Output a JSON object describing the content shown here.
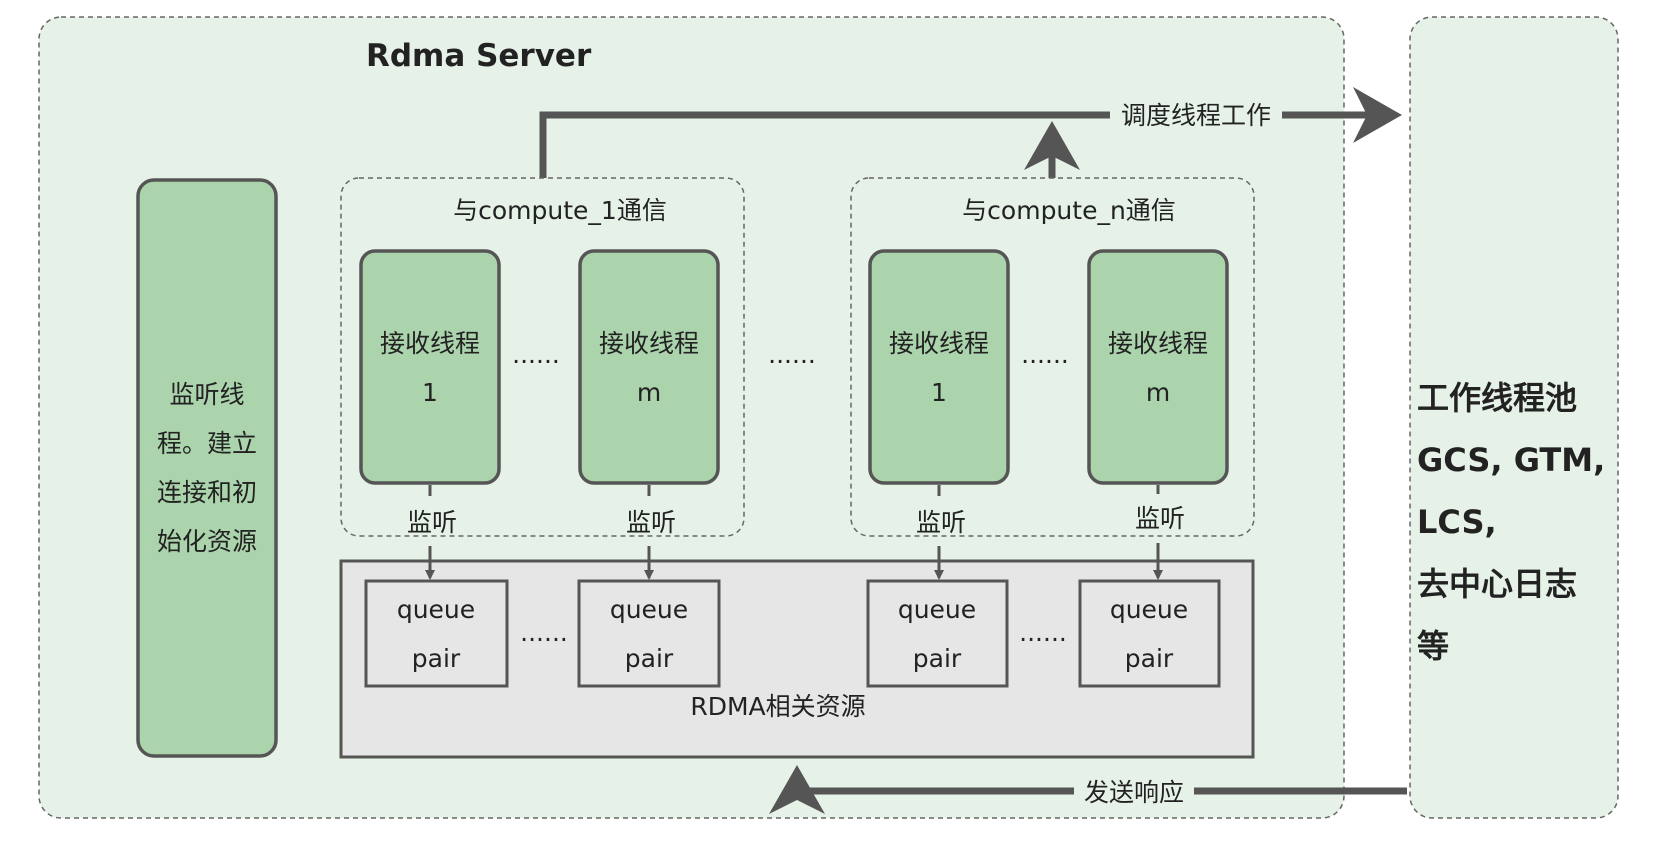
{
  "title": "Rdma Server",
  "listener": {
    "lines": [
      "监听线",
      "程。建立",
      "连接和初",
      "始化资源"
    ]
  },
  "groups": [
    {
      "label": "与compute_1通信",
      "threads": [
        {
          "l1": "接收线程",
          "l2": "1"
        },
        {
          "l1": "接收线程",
          "l2": "m"
        }
      ]
    },
    {
      "label": "与compute_n通信",
      "threads": [
        {
          "l1": "接收线程",
          "l2": "1"
        },
        {
          "l1": "接收线程",
          "l2": "m"
        }
      ]
    }
  ],
  "listen_label": "监听",
  "ellipsis": "......",
  "queue_pair": {
    "l1": "queue",
    "l2": "pair"
  },
  "rdma_resources": "RDMA相关资源",
  "schedule_label": "调度线程工作",
  "response_label": "发送响应",
  "worker_pool": {
    "lines": [
      "工作线程池",
      "GCS, GTM,",
      "LCS,",
      "去中心日志",
      "等"
    ]
  },
  "colors": {
    "panel": "#e6f1e7",
    "thread": "#abd4ad",
    "rdma": "#e6e6e6",
    "stroke": "#555555"
  }
}
